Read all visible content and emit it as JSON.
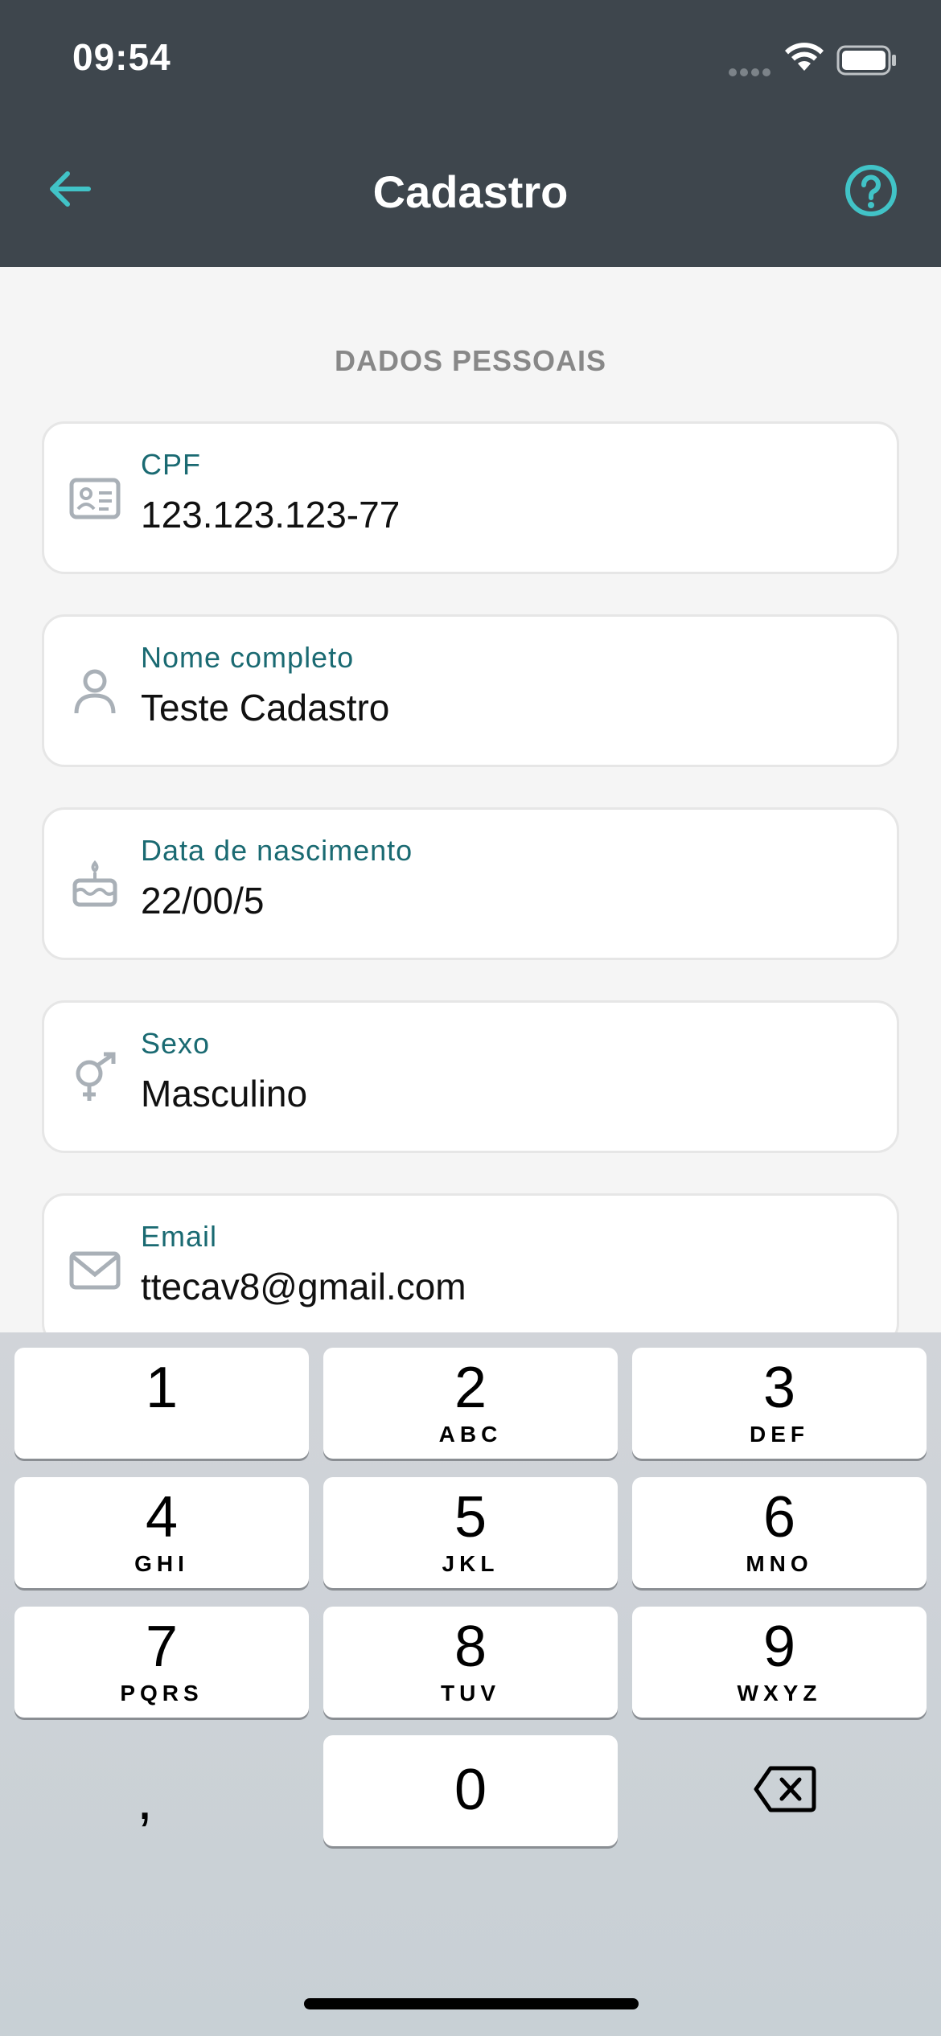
{
  "status_bar": {
    "time": "09:54"
  },
  "header": {
    "title": "Cadastro"
  },
  "form": {
    "section_title": "DADOS PESSOAIS",
    "fields": [
      {
        "label": "CPF",
        "value": "123.123.123-77",
        "icon": "id-card-icon"
      },
      {
        "label": "Nome completo",
        "value": "Teste Cadastro",
        "icon": "person-icon"
      },
      {
        "label": "Data de nascimento",
        "value": "22/00/5",
        "icon": "cake-icon"
      },
      {
        "label": "Sexo",
        "value": "Masculino",
        "icon": "gender-icon"
      },
      {
        "label": "Email",
        "value": "ttecav8@gmail.com",
        "icon": "mail-icon"
      }
    ]
  },
  "keyboard": {
    "keys": [
      {
        "digit": "1",
        "letters": ""
      },
      {
        "digit": "2",
        "letters": "ABC"
      },
      {
        "digit": "3",
        "letters": "DEF"
      },
      {
        "digit": "4",
        "letters": "GHI"
      },
      {
        "digit": "5",
        "letters": "JKL"
      },
      {
        "digit": "6",
        "letters": "MNO"
      },
      {
        "digit": "7",
        "letters": "PQRS"
      },
      {
        "digit": "8",
        "letters": "TUV"
      },
      {
        "digit": "9",
        "letters": "WXYZ"
      },
      {
        "digit": "0",
        "letters": ""
      }
    ],
    "comma": ","
  },
  "colors": {
    "header_bg": "#3e464d",
    "accent": "#41c3c7",
    "label": "#1a6a72"
  }
}
